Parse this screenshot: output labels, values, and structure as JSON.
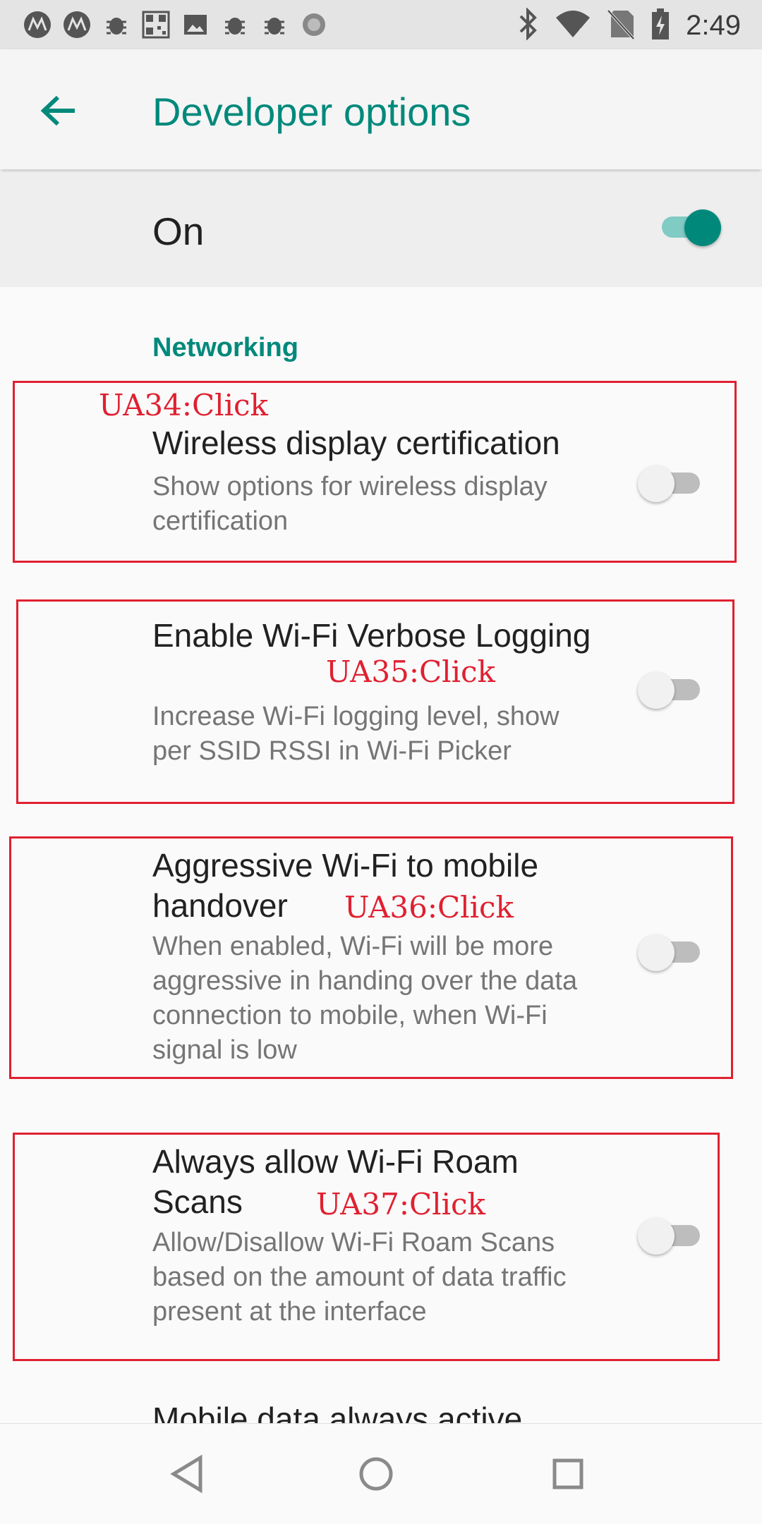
{
  "status_bar": {
    "time": "2:49",
    "left_icons": [
      "motorola-icon",
      "motorola-icon",
      "bug-icon",
      "qr-icon",
      "image-icon",
      "bug-icon",
      "bug-icon",
      "sync-icon"
    ],
    "right_icons": [
      "bluetooth-icon",
      "wifi-icon",
      "no-sim-icon",
      "battery-icon"
    ]
  },
  "app_bar": {
    "title": "Developer options"
  },
  "master_switch": {
    "label": "On",
    "state": true
  },
  "section": {
    "header": "Networking"
  },
  "preferences": [
    {
      "title": "Wireless display certification",
      "summary": "Show options for wireless display certification",
      "enabled": false
    },
    {
      "title": "Enable Wi-Fi Verbose Logging",
      "summary": "Increase Wi-Fi logging level, show per SSID RSSI in Wi-Fi Picker",
      "enabled": false
    },
    {
      "title": "Aggressive Wi-Fi to mobile handover",
      "summary": "When enabled, Wi-Fi will be more aggressive in handing over the data connection to mobile, when Wi-Fi signal is low",
      "enabled": false
    },
    {
      "title": "Always allow Wi-Fi Roam Scans",
      "summary": "Allow/Disallow Wi-Fi Roam Scans based on the amount of data traffic present at the interface",
      "enabled": false
    }
  ],
  "cutoff_item": {
    "title": "Mobile data always active"
  },
  "annotations": [
    "UA34:Click",
    "UA35:Click",
    "UA36:Click",
    "UA37:Click"
  ],
  "colors": {
    "accent": "#00897b",
    "annotation": "#e02030"
  }
}
